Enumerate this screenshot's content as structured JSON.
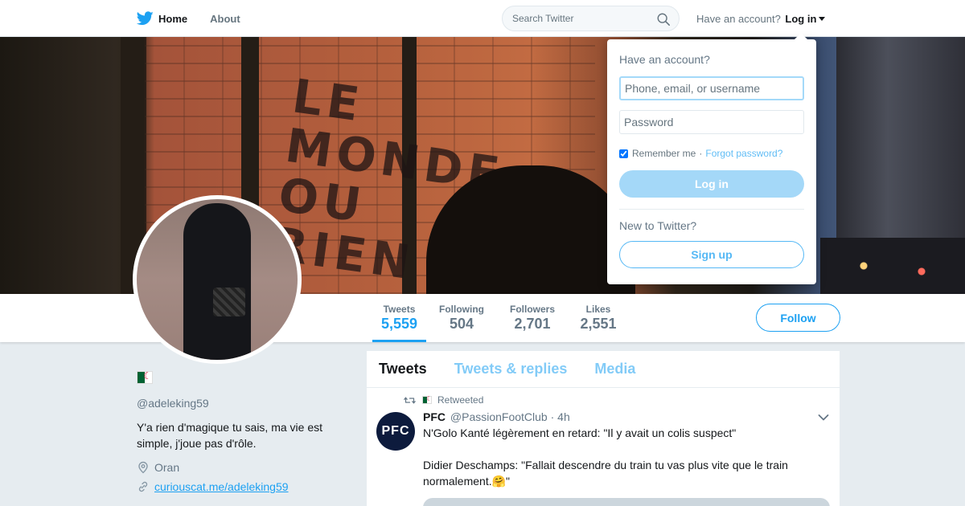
{
  "nav": {
    "home_label": "Home",
    "about_label": "About",
    "search_placeholder": "Search Twitter",
    "have_account": "Have an account?",
    "login_label": "Log in"
  },
  "profile_nav": {
    "stats": [
      {
        "label": "Tweets",
        "value": "5,559",
        "active": true
      },
      {
        "label": "Following",
        "value": "504",
        "active": false
      },
      {
        "label": "Followers",
        "value": "2,701",
        "active": false
      },
      {
        "label": "Likes",
        "value": "2,551",
        "active": false
      }
    ],
    "follow_label": "Follow"
  },
  "profile": {
    "handle": "@adeleking59",
    "bio": "Y'a rien d'magique tu sais, ma vie est simple, j'joue pas d'rôle.",
    "location": "Oran",
    "website": "curiouscat.me/adeleking59"
  },
  "banner": {
    "graffiti": [
      "LE",
      "MONDE",
      "OU",
      "RIEN"
    ]
  },
  "timeline": {
    "tabs": [
      {
        "label": "Tweets",
        "active": true
      },
      {
        "label": "Tweets & replies",
        "active": false
      },
      {
        "label": "Media",
        "active": false
      }
    ],
    "tweet": {
      "retweeted_label": "Retweeted",
      "avatar_text": "PFC",
      "name": "PFC",
      "handle": "@PassionFootClub",
      "time": "· 4h",
      "line1": "N'Golo Kanté légèrement en retard: \"Il y avait un colis suspect\"",
      "line2": "Didier Deschamps: \"Fallait descendre du train tu vas plus vite que le train normalement.🤗\""
    }
  },
  "login_dropdown": {
    "title": "Have an account?",
    "username_placeholder": "Phone, email, or username",
    "password_placeholder": "Password",
    "remember_label": "Remember me",
    "separator": "·",
    "forgot_label": "Forgot password?",
    "login_button": "Log in",
    "new_label": "New to Twitter?",
    "signup_button": "Sign up"
  },
  "colors": {
    "accent": "#1da1f2",
    "background": "#e6ecf0",
    "muted_text": "#657786"
  }
}
